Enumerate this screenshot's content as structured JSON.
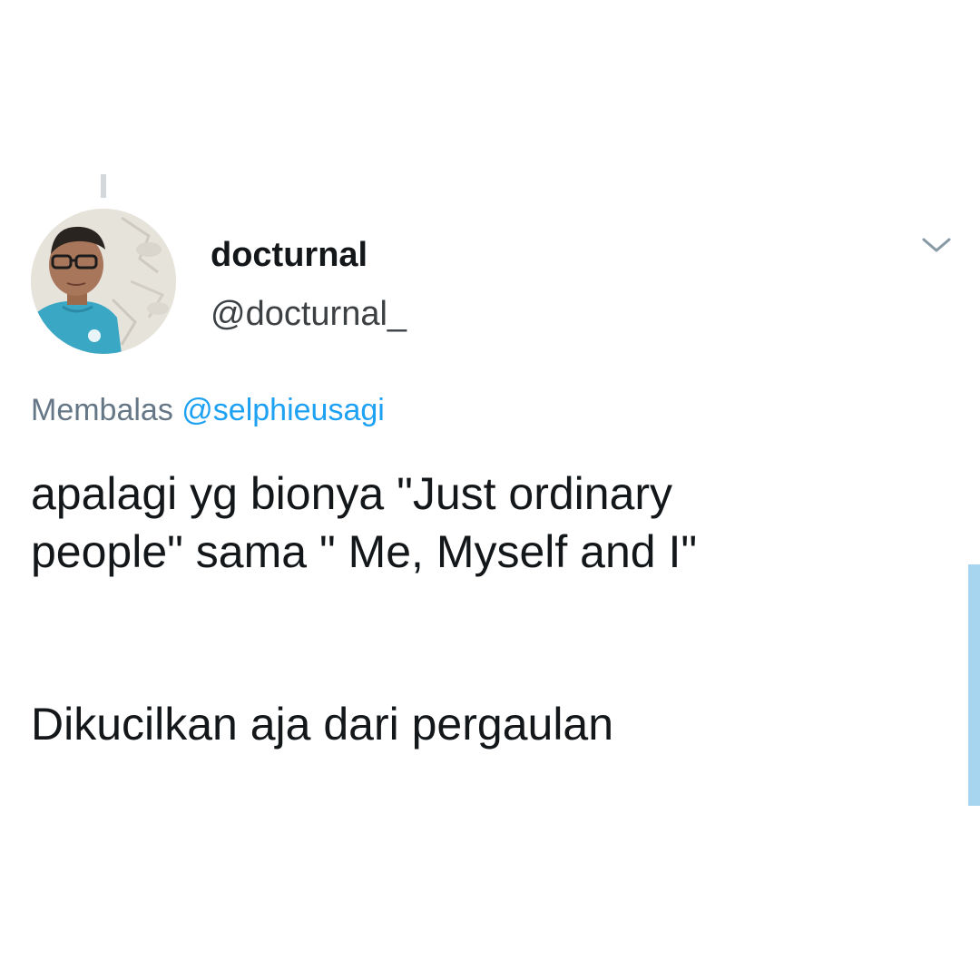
{
  "tweet": {
    "author": {
      "display_name": "docturnal",
      "handle": "@docturnal_",
      "avatar": "profile-photo"
    },
    "more_icon": "chevron-down-icon",
    "reply_context": {
      "prefix": "Membalas",
      "mention": "@selphieusagi"
    },
    "text_lines": [
      "apalagi yg bionya \"Just ordinary",
      "people\" sama \" Me, Myself and I\"",
      "Dikucilkan aja dari pergaulan"
    ]
  },
  "colors": {
    "text": "#14171a",
    "secondary_text": "#657786",
    "link": "#1da1f2",
    "thread_line": "#d2d8dc",
    "scroll_indicator": "#a7d4ee",
    "background": "#ffffff"
  }
}
